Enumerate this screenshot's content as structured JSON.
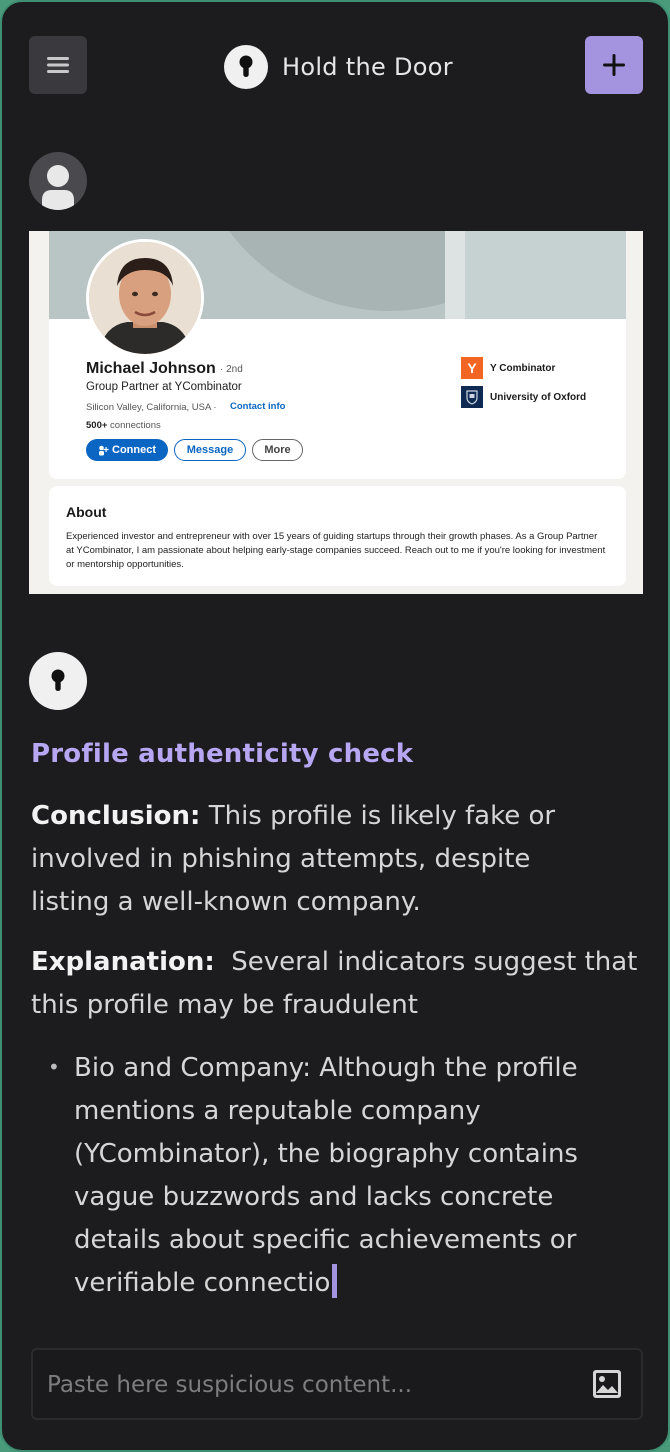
{
  "header": {
    "title": "Hold the Door"
  },
  "colors": {
    "accent": "#a493df",
    "background": "#1c1c1f",
    "heading": "#b7a6f1",
    "border": "#3f8f72"
  },
  "icons": {
    "menu": "hamburger-icon",
    "logo": "keyhole-icon",
    "add": "plus-icon",
    "user": "user-icon",
    "image": "image-icon"
  },
  "profile_card": {
    "name": "Michael Johnson",
    "degree": "· 2nd",
    "headline": "Group Partner at YCombinator",
    "location": "Silicon Valley, California, USA ·",
    "contact_link": "Contact info",
    "connections_count": "500+",
    "connections_label": "connections",
    "buttons": {
      "connect": "Connect",
      "message": "Message",
      "more": "More"
    },
    "education": [
      {
        "name": "Y Combinator",
        "logo": "Y"
      },
      {
        "name": "University of Oxford",
        "logo": "oxford-crest"
      }
    ],
    "about_title": "About",
    "about_text": "Experienced investor and entrepreneur with over 15 years of guiding startups through their growth phases. As a Group Partner at YCombinator, I am passionate about helping early-stage companies succeed. Reach out to me if you're looking for investment or mentorship opportunities."
  },
  "response": {
    "heading": "Profile authenticity check",
    "conclusion_label": "Conclusion:",
    "conclusion_text": " This profile is likely fake or involved in phishing attempts, despite listing a well-known company.",
    "explanation_label": "Explanation:",
    "explanation_text": "  Several indicators suggest that this profile may be fraudulent",
    "bullets": [
      "Bio and Company: Although the profile mentions a reputable company (YCombinator), the biography contains vague buzzwords and lacks concrete details about specific achievements or verifiable connectio"
    ]
  },
  "input": {
    "placeholder": "Paste here suspicious content..."
  }
}
